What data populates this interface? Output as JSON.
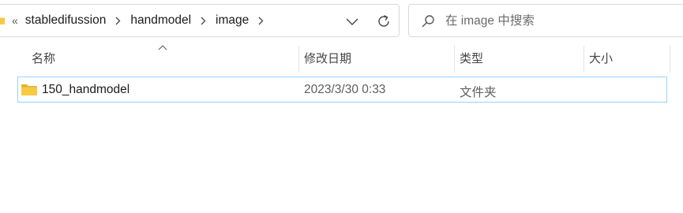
{
  "address_bar": {
    "overflow_glyph": "«",
    "breadcrumbs": [
      "stabledifussion",
      "handmodel",
      "image"
    ]
  },
  "search": {
    "placeholder": "在 image 中搜索"
  },
  "columns": {
    "name": "名称",
    "modified": "修改日期",
    "type": "类型",
    "size": "大小"
  },
  "files": [
    {
      "name": "150_handmodel",
      "modified": "2023/3/30 0:33",
      "type": "文件夹",
      "size": "",
      "icon": "folder-icon"
    }
  ],
  "colors": {
    "folder": "#f8c942",
    "selection_border": "#99d1ff"
  }
}
